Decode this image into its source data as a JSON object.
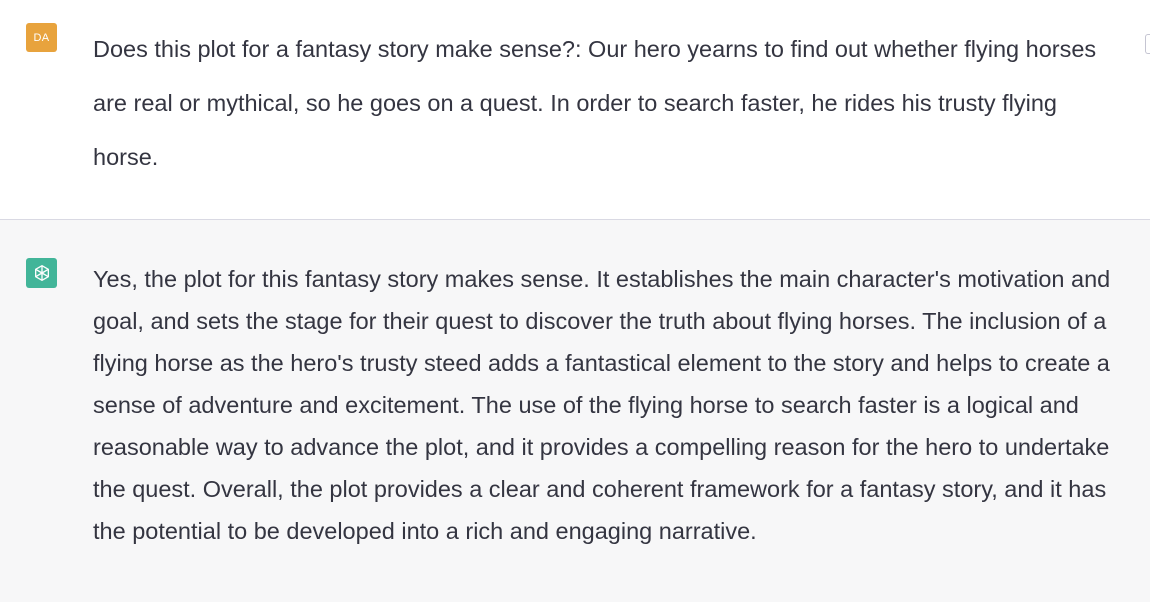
{
  "user_message": {
    "avatar_initials": "DA",
    "text": "Does this plot for a fantasy story make sense?: Our hero yearns to find out whether flying horses are real or mythical, so he goes on a quest. In order to search faster, he rides his trusty flying horse."
  },
  "assistant_message": {
    "avatar_icon": "openai-logo-icon",
    "text": "Yes, the plot for this fantasy story makes sense. It establishes the main character's motivation and goal, and sets the stage for their quest to discover the truth about flying horses. The inclusion of a flying horse as the hero's trusty steed adds a fantastical element to the story and helps to create a sense of adventure and excitement. The use of the flying horse to search faster is a logical and reasonable way to advance the plot, and it provides a compelling reason for the hero to undertake the quest. Overall, the plot provides a clear and coherent framework for a fantasy story, and it has the potential to be developed into a rich and engaging narrative."
  },
  "colors": {
    "user_avatar": "#e8a33d",
    "assistant_avatar": "#10a37f",
    "text": "#343541",
    "assistant_background": "#f7f7f8"
  }
}
